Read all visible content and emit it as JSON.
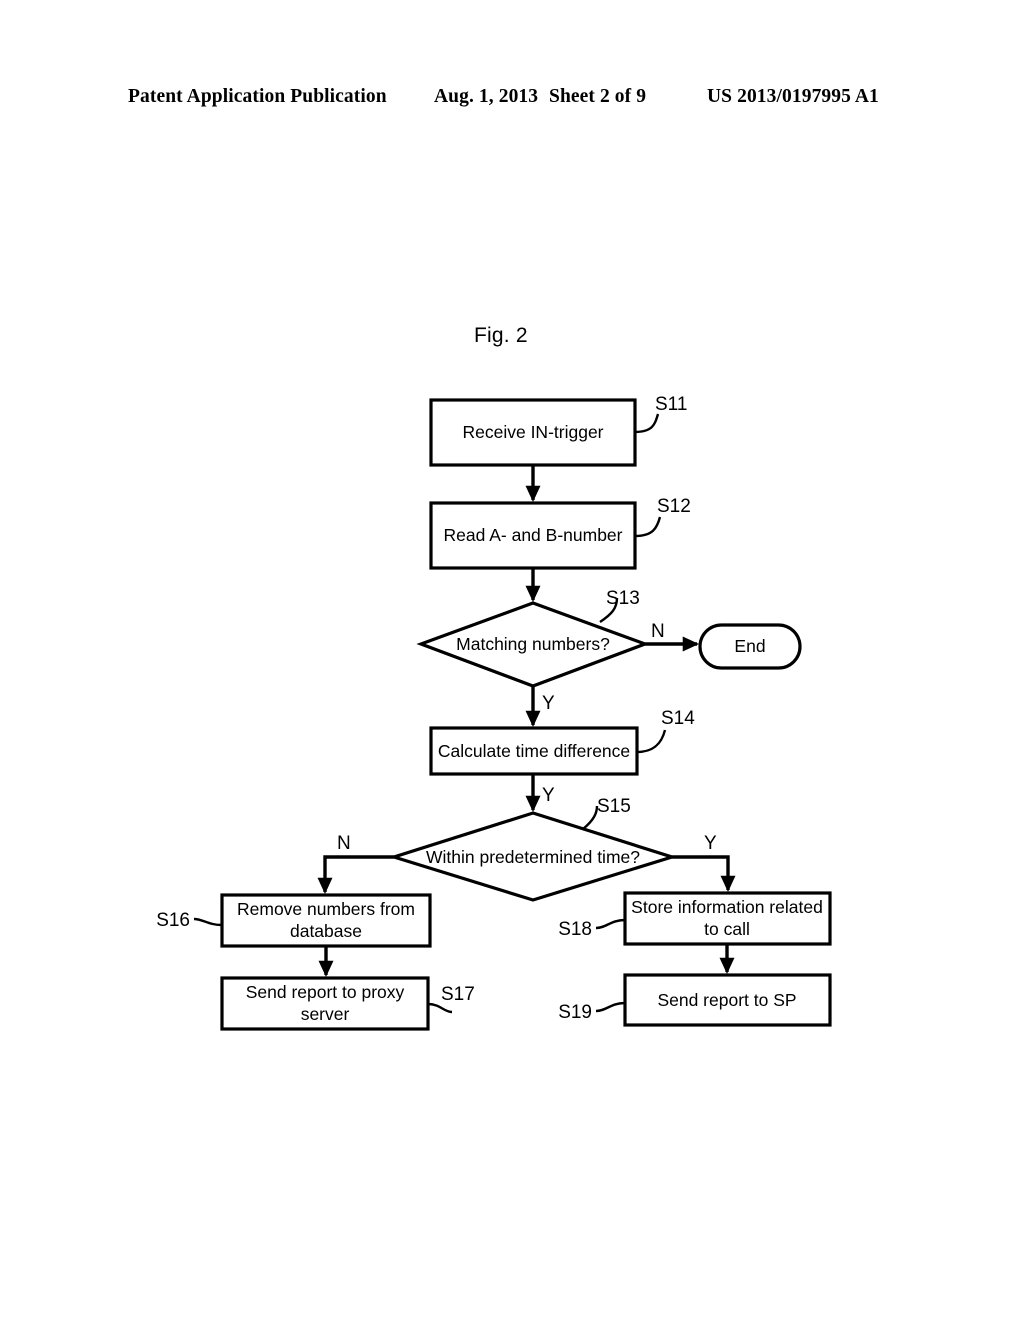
{
  "header": {
    "publication": "Patent Application Publication",
    "date": "Aug. 1, 2013",
    "sheet": "Sheet 2 of 9",
    "number": "US 2013/0197995 A1"
  },
  "figure": {
    "caption": "Fig. 2"
  },
  "flowchart": {
    "nodes": {
      "s11": {
        "label": "Receive IN-trigger",
        "step": "S11",
        "shape": "process"
      },
      "s12": {
        "label": "Read A- and B-number",
        "step": "S12",
        "shape": "process"
      },
      "s13": {
        "label": "Matching numbers?",
        "step": "S13",
        "shape": "decision"
      },
      "end": {
        "label": "End",
        "shape": "terminator"
      },
      "s14": {
        "label": "Calculate time difference",
        "step": "S14",
        "shape": "process"
      },
      "s15": {
        "label": "Within predetermined time?",
        "step": "S15",
        "shape": "decision"
      },
      "s16": {
        "label_line1": "Remove numbers from",
        "label_line2": "database",
        "step": "S16",
        "shape": "process"
      },
      "s17": {
        "label_line1": "Send report to proxy",
        "label_line2": "server",
        "step": "S17",
        "shape": "process"
      },
      "s18": {
        "label_line1": "Store information related",
        "label_line2": "to call",
        "step": "S18",
        "shape": "process"
      },
      "s19": {
        "label": "Send report to SP",
        "step": "S19",
        "shape": "process"
      }
    },
    "branches": {
      "s13_no": "N",
      "s13_yes": "Y",
      "s14_yes": "Y",
      "s15_no": "N",
      "s15_yes": "Y"
    },
    "colors": {
      "stroke": "#000000",
      "fill": "#ffffff",
      "text": "#000000"
    }
  }
}
